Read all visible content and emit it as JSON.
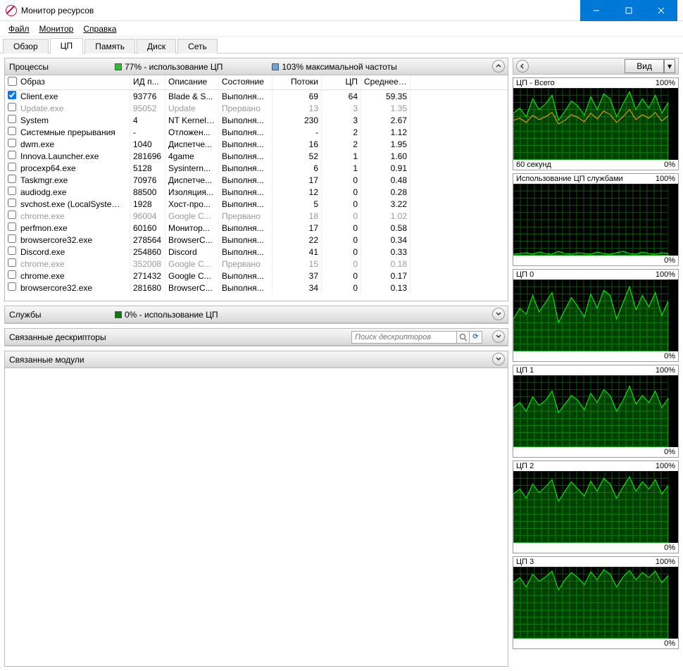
{
  "window": {
    "title": "Монитор ресурсов"
  },
  "menu": {
    "file": "Файл",
    "monitor": "Монитор",
    "help": "Справка"
  },
  "tabs": {
    "overview": "Обзор",
    "cpu": "ЦП",
    "memory": "Память",
    "disk": "Диск",
    "network": "Сеть"
  },
  "panels": {
    "processes": {
      "title": "Процессы",
      "stat1": "77% - использование ЦП",
      "stat2": "103% максимальной частоты",
      "color1": "#2dbf2d",
      "color2": "#6aa3e0"
    },
    "services": {
      "title": "Службы",
      "stat1": "0% - использование ЦП",
      "color1": "#0a7a0a"
    },
    "handles": {
      "title": "Связанные дескрипторы",
      "search_placeholder": "Поиск дескрипторов"
    },
    "modules": {
      "title": "Связанные модули"
    }
  },
  "columns": {
    "image": "Образ",
    "pid": "ИД п...",
    "desc": "Описание",
    "state": "Состояние",
    "threads": "Потоки",
    "cpu": "ЦП",
    "avg": "Среднее ..."
  },
  "processes": [
    {
      "chk": true,
      "img": "Client.exe",
      "pid": "93776",
      "desc": "Blade & S...",
      "state": "Выполня...",
      "threads": "69",
      "cpu": "64",
      "avg": "59.35",
      "susp": false
    },
    {
      "chk": false,
      "img": "Update.exe",
      "pid": "95052",
      "desc": "Update",
      "state": "Прервано",
      "threads": "13",
      "cpu": "3",
      "avg": "1.35",
      "susp": true
    },
    {
      "chk": false,
      "img": "System",
      "pid": "4",
      "desc": "NT Kernel ...",
      "state": "Выполня...",
      "threads": "230",
      "cpu": "3",
      "avg": "2.67",
      "susp": false
    },
    {
      "chk": false,
      "img": "Системные прерывания",
      "pid": "-",
      "desc": "Отложен...",
      "state": "Выполня...",
      "threads": "-",
      "cpu": "2",
      "avg": "1.12",
      "susp": false
    },
    {
      "chk": false,
      "img": "dwm.exe",
      "pid": "1040",
      "desc": "Диспетче...",
      "state": "Выполня...",
      "threads": "16",
      "cpu": "2",
      "avg": "1.95",
      "susp": false
    },
    {
      "chk": false,
      "img": "Innova.Launcher.exe",
      "pid": "281696",
      "desc": "4game",
      "state": "Выполня...",
      "threads": "52",
      "cpu": "1",
      "avg": "1.60",
      "susp": false
    },
    {
      "chk": false,
      "img": "procexp64.exe",
      "pid": "5128",
      "desc": "Sysintern...",
      "state": "Выполня...",
      "threads": "6",
      "cpu": "1",
      "avg": "0.91",
      "susp": false
    },
    {
      "chk": false,
      "img": "Taskmgr.exe",
      "pid": "70976",
      "desc": "Диспетче...",
      "state": "Выполня...",
      "threads": "17",
      "cpu": "0",
      "avg": "0.48",
      "susp": false
    },
    {
      "chk": false,
      "img": "audiodg.exe",
      "pid": "88500",
      "desc": "Изоляция...",
      "state": "Выполня...",
      "threads": "12",
      "cpu": "0",
      "avg": "0.28",
      "susp": false
    },
    {
      "chk": false,
      "img": "svchost.exe (LocalSystemNet...",
      "pid": "1928",
      "desc": "Хост-про...",
      "state": "Выполня...",
      "threads": "5",
      "cpu": "0",
      "avg": "3.22",
      "susp": false
    },
    {
      "chk": false,
      "img": "chrome.exe",
      "pid": "96004",
      "desc": "Google C...",
      "state": "Прервано",
      "threads": "18",
      "cpu": "0",
      "avg": "1.02",
      "susp": true
    },
    {
      "chk": false,
      "img": "perfmon.exe",
      "pid": "60160",
      "desc": "Монитор...",
      "state": "Выполня...",
      "threads": "17",
      "cpu": "0",
      "avg": "0.58",
      "susp": false
    },
    {
      "chk": false,
      "img": "browsercore32.exe",
      "pid": "278564",
      "desc": "BrowserC...",
      "state": "Выполня...",
      "threads": "22",
      "cpu": "0",
      "avg": "0.34",
      "susp": false
    },
    {
      "chk": false,
      "img": "Discord.exe",
      "pid": "254860",
      "desc": "Discord",
      "state": "Выполня...",
      "threads": "41",
      "cpu": "0",
      "avg": "0.33",
      "susp": false
    },
    {
      "chk": false,
      "img": "chrome.exe",
      "pid": "352008",
      "desc": "Google C...",
      "state": "Прервано",
      "threads": "15",
      "cpu": "0",
      "avg": "0.18",
      "susp": true
    },
    {
      "chk": false,
      "img": "chrome.exe",
      "pid": "271432",
      "desc": "Google C...",
      "state": "Выполня...",
      "threads": "37",
      "cpu": "0",
      "avg": "0.17",
      "susp": false
    },
    {
      "chk": false,
      "img": "browsercore32.exe",
      "pid": "281680",
      "desc": "BrowserC...",
      "state": "Выполня...",
      "threads": "34",
      "cpu": "0",
      "avg": "0.13",
      "susp": false
    }
  ],
  "right": {
    "view_label": "Вид",
    "sixty_sec": "60 секунд"
  },
  "charts": [
    {
      "title": "ЦП - Всего",
      "max": "100%",
      "foot_left": "60 секунд",
      "foot_right": "0%",
      "orange": true
    },
    {
      "title": "Использование ЦП службами",
      "max": "100%",
      "foot_left": "",
      "foot_right": "0%",
      "orange": false,
      "low": true
    },
    {
      "title": "ЦП 0",
      "max": "100%",
      "foot_left": "",
      "foot_right": "0%",
      "orange": false
    },
    {
      "title": "ЦП 1",
      "max": "100%",
      "foot_left": "",
      "foot_right": "0%",
      "orange": false
    },
    {
      "title": "ЦП 2",
      "max": "100%",
      "foot_left": "",
      "foot_right": "0%",
      "orange": false
    },
    {
      "title": "ЦП 3",
      "max": "100%",
      "foot_left": "",
      "foot_right": "0%",
      "orange": false
    }
  ],
  "chart_data": [
    {
      "type": "area",
      "title": "ЦП - Всего",
      "ylim": [
        0,
        100
      ],
      "series": [
        {
          "name": "usage",
          "values": [
            65,
            72,
            60,
            85,
            70,
            78,
            90,
            55,
            68,
            82,
            75,
            62,
            88,
            70,
            92,
            85,
            60,
            78,
            95,
            70,
            85,
            72,
            90,
            65,
            80
          ]
        },
        {
          "name": "freq",
          "values": [
            55,
            58,
            52,
            62,
            56,
            60,
            66,
            50,
            55,
            63,
            59,
            53,
            65,
            57,
            68,
            63,
            52,
            60,
            70,
            56,
            63,
            58,
            66,
            54,
            61
          ]
        }
      ]
    },
    {
      "type": "area",
      "title": "Использование ЦП службами",
      "ylim": [
        0,
        100
      ],
      "series": [
        {
          "name": "usage",
          "values": [
            2,
            3,
            4,
            2,
            5,
            3,
            2,
            6,
            3,
            2,
            4,
            3,
            2,
            5,
            3,
            2,
            4,
            6,
            3,
            2,
            5,
            3,
            2,
            4,
            3
          ]
        }
      ]
    },
    {
      "type": "area",
      "title": "ЦП 0",
      "ylim": [
        0,
        100
      ],
      "series": [
        {
          "name": "usage",
          "values": [
            45,
            60,
            52,
            78,
            55,
            68,
            82,
            40,
            58,
            75,
            62,
            48,
            80,
            60,
            85,
            78,
            45,
            68,
            90,
            58,
            78,
            62,
            82,
            50,
            70
          ]
        }
      ]
    },
    {
      "type": "area",
      "title": "ЦП 1",
      "ylim": [
        0,
        100
      ],
      "series": [
        {
          "name": "usage",
          "values": [
            55,
            62,
            50,
            70,
            58,
            65,
            78,
            48,
            60,
            72,
            65,
            52,
            75,
            62,
            80,
            72,
            50,
            65,
            85,
            60,
            72,
            62,
            78,
            55,
            68
          ]
        }
      ]
    },
    {
      "type": "area",
      "title": "ЦП 2",
      "ylim": [
        0,
        100
      ],
      "series": [
        {
          "name": "usage",
          "values": [
            68,
            75,
            62,
            82,
            70,
            78,
            88,
            58,
            72,
            85,
            75,
            65,
            86,
            72,
            90,
            82,
            62,
            78,
            92,
            72,
            85,
            75,
            88,
            68,
            80
          ]
        }
      ]
    },
    {
      "type": "area",
      "title": "ЦП 3",
      "ylim": [
        0,
        100
      ],
      "series": [
        {
          "name": "usage",
          "values": [
            78,
            85,
            72,
            90,
            80,
            86,
            94,
            68,
            82,
            92,
            85,
            75,
            93,
            82,
            96,
            90,
            72,
            86,
            95,
            82,
            92,
            85,
            94,
            78,
            88
          ]
        }
      ]
    }
  ]
}
